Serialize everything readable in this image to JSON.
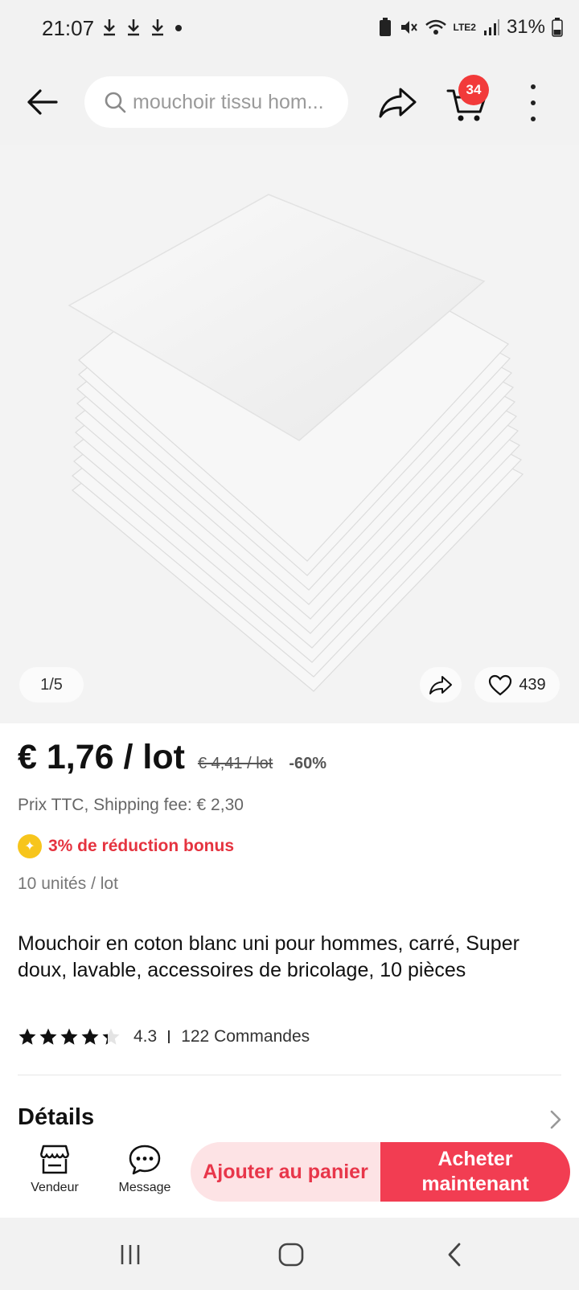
{
  "status_bar": {
    "time": "21:07",
    "battery": "31%",
    "network": "LTE2"
  },
  "top_bar": {
    "search_placeholder": "mouchoir tissu hom...",
    "cart_count": "34"
  },
  "gallery": {
    "counter": "1/5",
    "likes": "439"
  },
  "product": {
    "price": "€ 1,76 / lot",
    "old_price": "€ 4,41 / lot",
    "discount": "-60%",
    "tax_shipping": "Prix TTC, Shipping fee: € 2,30",
    "bonus": "3% de réduction bonus",
    "units": "10 unités / lot",
    "title": "Mouchoir en coton blanc uni pour hommes, carré, Super doux, lavable, accessoires de bricolage, 10 pièces",
    "rating": "4.3",
    "orders": "122 Commandes",
    "details_label": "Détails"
  },
  "bottom_bar": {
    "store_label": "Vendeur",
    "message_label": "Message",
    "add_to_cart": "Ajouter au panier",
    "buy_now": "Acheter maintenant"
  },
  "colors": {
    "accent_red": "#f23d52",
    "accent_light": "#fde3e5",
    "badge_red": "#f23a3a",
    "bonus_coin": "#f7c51c"
  }
}
